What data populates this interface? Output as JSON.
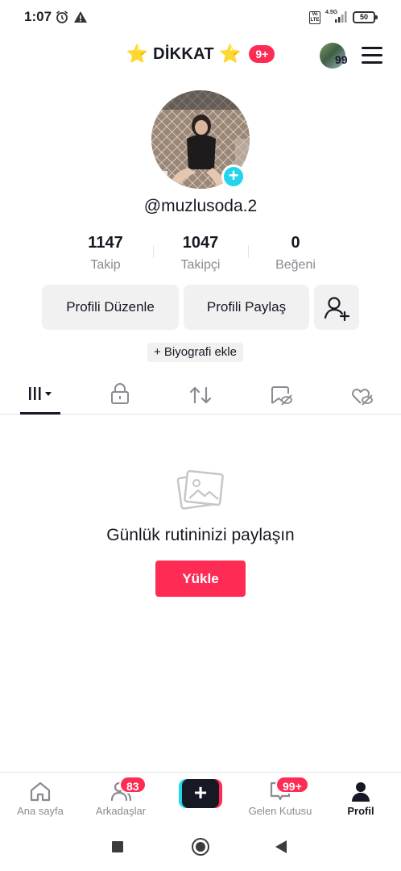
{
  "status_bar": {
    "time": "1:07",
    "volte": "Vo LTE",
    "network": "4.5G",
    "battery": "50"
  },
  "header": {
    "title": "DİKKAT",
    "star_left": "⭐",
    "star_right": "⭐",
    "title_badge": "9+",
    "avatar_count": "99"
  },
  "profile": {
    "username": "@muzlusoda.2",
    "add_icon": "+",
    "stats": [
      {
        "value": "1147",
        "label": "Takip"
      },
      {
        "value": "1047",
        "label": "Takipçi"
      },
      {
        "value": "0",
        "label": "Beğeni"
      }
    ],
    "edit_button": "Profili Düzenle",
    "share_button": "Profili Paylaş",
    "bio_chip": "+ Biyografi ekle"
  },
  "tabs": [
    {
      "icon": "grid-icon",
      "active": true
    },
    {
      "icon": "lock-icon",
      "active": false
    },
    {
      "icon": "repost-icon",
      "active": false
    },
    {
      "icon": "hidden-bookmark-icon",
      "active": false
    },
    {
      "icon": "hidden-like-icon",
      "active": false
    }
  ],
  "empty_state": {
    "title": "Günlük rutininizi paylaşın",
    "upload_button": "Yükle"
  },
  "bottom_nav": {
    "home": {
      "label": "Ana sayfa"
    },
    "friends": {
      "label": "Arkadaşlar",
      "badge": "83"
    },
    "create": {
      "symbol": "+"
    },
    "inbox": {
      "label": "Gelen Kutusu",
      "badge": "99+"
    },
    "profile": {
      "label": "Profil"
    }
  },
  "colors": {
    "accent": "#fe2c55",
    "cyan": "#20d5ec",
    "text": "#161823",
    "muted": "#8a8b91"
  }
}
